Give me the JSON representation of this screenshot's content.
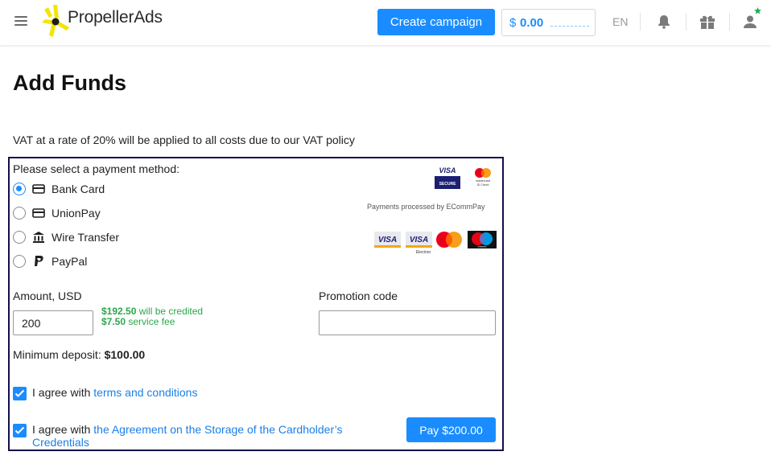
{
  "header": {
    "brand": "PropellerAds",
    "create_campaign": "Create campaign",
    "balance_currency": "$",
    "balance_amount": "0.00",
    "language": "EN",
    "icons": [
      "menu-icon",
      "bell-icon",
      "gift-icon",
      "user-icon"
    ]
  },
  "page": {
    "title": "Add Funds",
    "vat_notice": "VAT at a rate of 20% will be applied to all costs due to our VAT policy"
  },
  "payment": {
    "select_label": "Please select a payment method:",
    "methods": [
      {
        "label": "Bank Card",
        "icon": "card-icon",
        "selected": true
      },
      {
        "label": "UnionPay",
        "icon": "card-icon",
        "selected": false
      },
      {
        "label": "Wire Transfer",
        "icon": "bank-icon",
        "selected": false
      },
      {
        "label": "PayPal",
        "icon": "paypal-icon",
        "selected": false
      }
    ],
    "processed_by": "Payments processed by ECommPay",
    "logo_texts": {
      "visa": "VISA",
      "secure": "SECURE",
      "mc_idcheck_top": "mastercard",
      "mc_idcheck_bottom": "ID Check",
      "electron": "Electron",
      "maestro": "maestro"
    }
  },
  "form": {
    "amount_label": "Amount, USD",
    "amount_value": "200",
    "credited_amount": "$192.50",
    "credited_text": " will be credited",
    "fee_amount": "$7.50",
    "fee_text": " service fee",
    "promo_label": "Promotion code",
    "promo_value": "",
    "min_deposit_label": "Minimum deposit: ",
    "min_deposit_value": "$100.00"
  },
  "agreements": {
    "terms_prefix": "I agree with ",
    "terms_link": "terms and conditions",
    "storage_prefix": "I agree with ",
    "storage_link_1": "the Agreement on the Storage of the Cardholder’s",
    "storage_link_2": "Credentials",
    "terms_checked": true,
    "storage_checked": true
  },
  "pay_button": "Pay $200.00",
  "colors": {
    "accent": "#1a8cff",
    "success": "#2aa84a",
    "panel_border": "#14104a",
    "logo_yellow": "#f2e600"
  }
}
